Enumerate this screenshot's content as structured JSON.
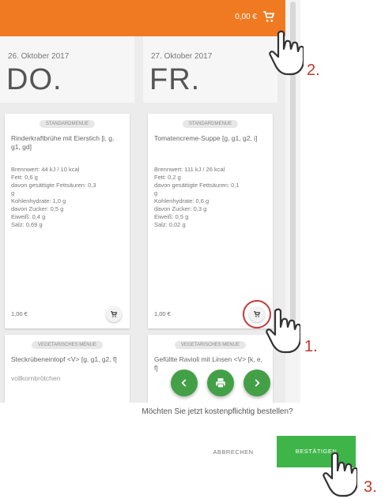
{
  "header": {
    "cart_total": "0,00 €",
    "cart_icon": "cart-icon"
  },
  "days": [
    {
      "date": "26. Oktober 2017",
      "day": "DO.",
      "menus": [
        {
          "badge": "STANDARDMENUE",
          "dish": "Rinderkraftbrühe mit Eierstich [i, g, g1, gd]",
          "nutrition": [
            "Brennwert: 44 kJ / 10 kcal",
            "Fett: 0,6 g",
            "davon gesättigte Fettsäuren: 0,3",
            "g",
            "Kohlenhydrate: 1,0 g",
            "davon Zucker: 0,5 g",
            "Eiweiß: 0,4 g",
            "Salz: 0,69 g"
          ],
          "price": "1,00 €"
        },
        {
          "badge": "VEGETARISCHES MENUE",
          "dish": "Steckrübeneintopf <V> [g, g1, g2, f]",
          "extra": "vollkornbrötchen"
        }
      ]
    },
    {
      "date": "27. Oktober 2017",
      "day": "FR.",
      "menus": [
        {
          "badge": "STANDARDMENUE",
          "dish": "Tomatencreme-Suppe [g, g1, g2, i]",
          "nutrition": [
            "Brennwert: 111 kJ / 26 kcal",
            "Fett: 0,2 g",
            "davon gesättigte Fettsäuren: 0,1",
            "g",
            "Kohlenhydrate: 0,6 g",
            "davon Zucker: 0,3 g",
            "Eiweiß: 0,5 g",
            "Salz: 0,02 g"
          ],
          "price": "1,00 €"
        },
        {
          "badge": "VEGETARISCHES MENUE",
          "dish": "Gefüllte Ravioli mit Linsen <V> [k, e, f]"
        }
      ]
    }
  ],
  "dialog": {
    "question": "Möchten Sie jetzt kostenpflichtig bestellen?",
    "cancel": "ABBRECHEN",
    "confirm": "BESTÄTIGEN"
  },
  "steps": [
    "1.",
    "2.",
    "3."
  ],
  "colors": {
    "accent": "#f07a22",
    "fab": "#43a047",
    "confirm": "#3fb549",
    "highlight": "#c43b3b"
  }
}
